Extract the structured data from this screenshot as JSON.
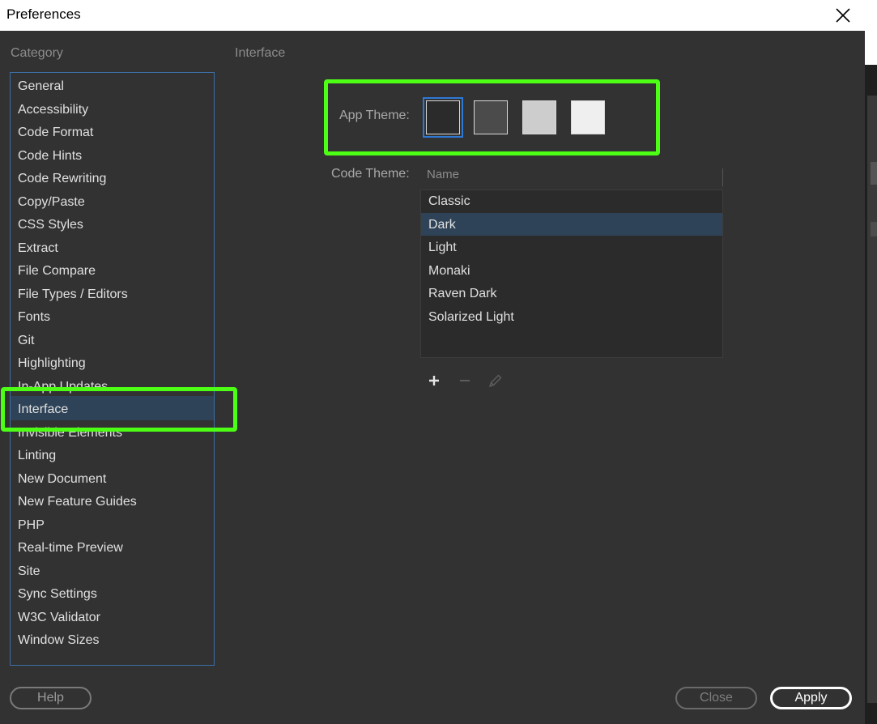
{
  "window": {
    "title": "Preferences"
  },
  "sidebar": {
    "title": "Category",
    "selected": "Interface",
    "items": [
      {
        "label": "General"
      },
      {
        "label": "Accessibility"
      },
      {
        "label": "Code Format"
      },
      {
        "label": "Code Hints"
      },
      {
        "label": "Code Rewriting"
      },
      {
        "label": "Copy/Paste"
      },
      {
        "label": "CSS Styles"
      },
      {
        "label": "Extract"
      },
      {
        "label": "File Compare"
      },
      {
        "label": "File Types / Editors"
      },
      {
        "label": "Fonts"
      },
      {
        "label": "Git"
      },
      {
        "label": "Highlighting"
      },
      {
        "label": "In-App Updates"
      },
      {
        "label": "Interface"
      },
      {
        "label": "Invisible Elements"
      },
      {
        "label": "Linting"
      },
      {
        "label": "New Document"
      },
      {
        "label": "New Feature Guides"
      },
      {
        "label": "PHP"
      },
      {
        "label": "Real-time Preview"
      },
      {
        "label": "Site"
      },
      {
        "label": "Sync Settings"
      },
      {
        "label": "W3C Validator"
      },
      {
        "label": "Window Sizes"
      }
    ]
  },
  "main": {
    "section_title": "Interface",
    "app_theme": {
      "label": "App Theme:",
      "selected": "darkest",
      "swatches": [
        {
          "name": "darkest",
          "color": "#2b2b2b"
        },
        {
          "name": "dark",
          "color": "#4b4b4b"
        },
        {
          "name": "light",
          "color": "#cdcdcd"
        },
        {
          "name": "lightest",
          "color": "#efefef"
        }
      ]
    },
    "code_theme": {
      "label": "Code Theme:",
      "column_header": "Name",
      "selected": "Dark",
      "items": [
        "Classic",
        "Dark",
        "Light",
        "Monaki",
        "Raven Dark",
        "Solarized Light"
      ]
    },
    "toolbar": [
      "add-icon",
      "remove-icon",
      "edit-pencil-icon"
    ]
  },
  "buttons": {
    "help": "Help",
    "close": "Close",
    "apply": "Apply"
  },
  "colors": {
    "highlight": "#4dff14",
    "selection": "#2f4358",
    "list_border": "#3d6fa6",
    "swatch_focus": "#2e79d5"
  }
}
